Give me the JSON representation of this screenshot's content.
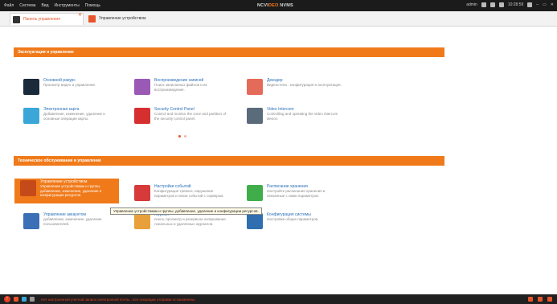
{
  "menubar": {
    "menus": [
      "Файл",
      "Система",
      "Вид",
      "Инструменты",
      "Помощь"
    ],
    "brand_prefix": "NCVI",
    "brand_mid": "DEO",
    "brand_suffix": " NVMS",
    "user": "admin",
    "time": "10:28:59"
  },
  "tabs": [
    {
      "label": "Панель управления"
    },
    {
      "label": "Управление устройством"
    }
  ],
  "sections": {
    "ops": {
      "title": "Эксплуатация и управление",
      "items": [
        {
          "title": "Основной ракурс",
          "desc": "Просмотр видео и управление.",
          "color": "#1b2a3a"
        },
        {
          "title": "Воспроизведение записей",
          "desc": "Поиск записанных файлов и их воспроизведение.",
          "color": "#9b59b6"
        },
        {
          "title": "Декодер",
          "desc": "Видеостена : конфигурация и эксплуатация.",
          "color": "#e46b5a"
        },
        {
          "title": "Электронная карта",
          "desc": "Добавление, изменение, удаление и основные операции карты.",
          "color": "#3aa7d8"
        },
        {
          "title": "Security Control Panel",
          "desc": "Control and monitor the zone and partition of the security control panel.",
          "color": "#d62f2f"
        },
        {
          "title": "Video Intercom",
          "desc": "Controlling and operating the video intercom device.",
          "color": "#5a6b7c"
        }
      ]
    },
    "maintenance": {
      "title": "Техническое обслуживание и управление",
      "items": [
        {
          "title": "Управление устройством",
          "desc": "Управление устройствами и группы добавление, изменение, удаление и конфигурация ресурсов.",
          "color": "#c54a1a"
        },
        {
          "title": "Настройки событий",
          "desc": "Конфигурация тревоги, нарушение параметров и связи событий с сервером.",
          "color": "#d63a3a"
        },
        {
          "title": "Расписание хранения",
          "desc": "Настройте расписания хранения и связанные с ними параметров.",
          "color": "#3fae4a"
        },
        {
          "title": "Управление аккаунтом",
          "desc": "добавление, изменение, удаление пользователей.",
          "color": "#3b6fb6"
        },
        {
          "title": "Журнал",
          "desc": "поиск, просмотр и резервное копирование локальных и удаленных журналов.",
          "color": "#e8a13a"
        },
        {
          "title": "Конфигурация системы",
          "desc": "Настройка общих параметров.",
          "color": "#2f6fb0"
        }
      ]
    }
  },
  "tooltip": "Управление устройствами и группы; добавление, удаление и конфигурации ресурсов.",
  "status": {
    "message": "Нет настроенной учетной записи электронной почты , все операции отправки остановлены."
  }
}
